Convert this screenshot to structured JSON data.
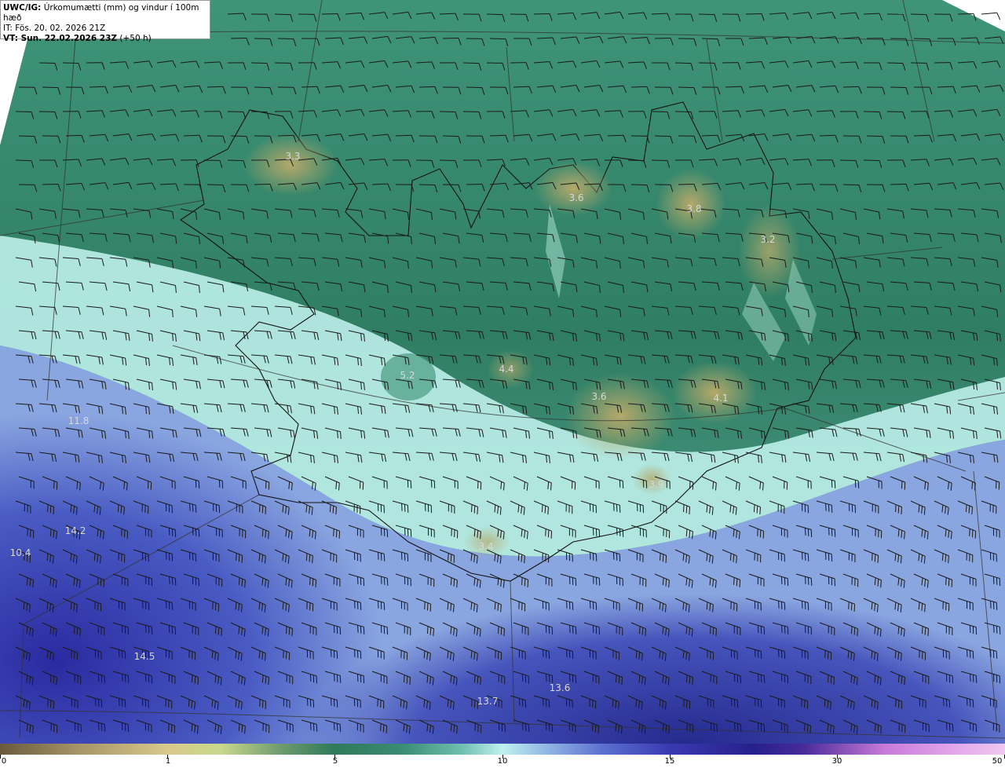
{
  "header": {
    "model": "UWC/IG:",
    "title": "Úrkomumætti (mm) og vindur í 100m hæð",
    "it_line": "IT: Fös. 20. 02. 2026 21Z",
    "vt_label": "VT: Sun. 22.02.2026 23Z",
    "vt_offset": "(+50 h)"
  },
  "map_labels": [
    "3.3",
    "3.6",
    "3.8",
    "3.2",
    "4.4",
    "5.2",
    "3.6",
    "4.1",
    "3.9",
    "3.4",
    "11.8",
    "14.2",
    "10.4",
    "14.5",
    "13.7",
    "13.6"
  ],
  "colorbar": {
    "ticks": [
      "0",
      "1",
      "5",
      "10",
      "15",
      "30",
      "50"
    ]
  },
  "colors": {
    "ocean_deep": "#2a2f9a",
    "ocean_mid": "#6a86d6",
    "ocean_light": "#bff2ee",
    "land_green": "#3f8a6c",
    "land_high": "#a9a36a",
    "sea_north": "#3a8a6e"
  }
}
